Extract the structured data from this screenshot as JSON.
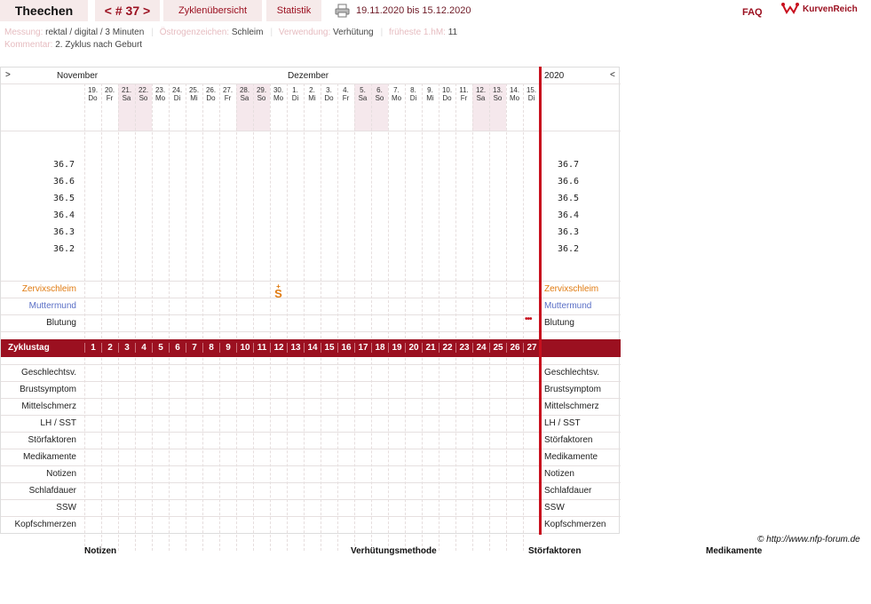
{
  "header": {
    "title": "Theechen",
    "cycle_prev": "<",
    "cycle_label": "# 37",
    "cycle_next": ">",
    "overview_label": "Zyklenübersicht",
    "stats_label": "Statistik",
    "date_range": "19.11.2020 bis 15.12.2020",
    "faq_label": "FAQ",
    "logo_text": "KurvenReich"
  },
  "meta": {
    "messung_key": "Messung:",
    "messung_val": "rektal / digital / 3 Minuten",
    "oestrogen_key": "Östrogenzeichen:",
    "oestrogen_val": "Schleim",
    "verwendung_key": "Verwendung:",
    "verwendung_val": "Verhütung",
    "fruehest_key": "früheste 1.hM:",
    "fruehest_val": "11",
    "kommentar_key": "Kommentar:",
    "kommentar_val": "2. Zyklus nach Geburt"
  },
  "chart": {
    "month_left": "November",
    "month_mid": "Dezember",
    "year": "2020",
    "nav_left": ">",
    "nav_right": "<",
    "days": [
      {
        "d": "19.",
        "w": "Do",
        "we": false
      },
      {
        "d": "20.",
        "w": "Fr",
        "we": false
      },
      {
        "d": "21.",
        "w": "Sa",
        "we": true
      },
      {
        "d": "22.",
        "w": "So",
        "we": true
      },
      {
        "d": "23.",
        "w": "Mo",
        "we": false
      },
      {
        "d": "24.",
        "w": "Di",
        "we": false
      },
      {
        "d": "25.",
        "w": "Mi",
        "we": false
      },
      {
        "d": "26.",
        "w": "Do",
        "we": false
      },
      {
        "d": "27.",
        "w": "Fr",
        "we": false
      },
      {
        "d": "28.",
        "w": "Sa",
        "we": true
      },
      {
        "d": "29.",
        "w": "So",
        "we": true
      },
      {
        "d": "30.",
        "w": "Mo",
        "we": false
      },
      {
        "d": "1.",
        "w": "Di",
        "we": false
      },
      {
        "d": "2.",
        "w": "Mi",
        "we": false
      },
      {
        "d": "3.",
        "w": "Do",
        "we": false
      },
      {
        "d": "4.",
        "w": "Fr",
        "we": false
      },
      {
        "d": "5.",
        "w": "Sa",
        "we": true
      },
      {
        "d": "6.",
        "w": "So",
        "we": true
      },
      {
        "d": "7.",
        "w": "Mo",
        "we": false
      },
      {
        "d": "8.",
        "w": "Di",
        "we": false
      },
      {
        "d": "9.",
        "w": "Mi",
        "we": false
      },
      {
        "d": "10.",
        "w": "Do",
        "we": false
      },
      {
        "d": "11.",
        "w": "Fr",
        "we": false
      },
      {
        "d": "12.",
        "w": "Sa",
        "we": true
      },
      {
        "d": "13.",
        "w": "So",
        "we": true
      },
      {
        "d": "14.",
        "w": "Mo",
        "we": false
      },
      {
        "d": "15.",
        "w": "Di",
        "we": false
      }
    ],
    "temps": [
      "36.7",
      "36.6",
      "36.5",
      "36.4",
      "36.3",
      "36.2"
    ],
    "zervix_label": "Zervixschleim",
    "muttermund_label": "Muttermund",
    "blutung_label": "Blutung",
    "zervix_mark_day": 12,
    "zervix_mark_symbol": "S",
    "zervix_mark_top": "+",
    "blutung_mark_day": 27,
    "zyklus_label": "Zyklustag",
    "zyklus_days": [
      "1",
      "2",
      "3",
      "4",
      "5",
      "6",
      "7",
      "8",
      "9",
      "10",
      "11",
      "12",
      "13",
      "14",
      "15",
      "16",
      "17",
      "18",
      "19",
      "20",
      "21",
      "22",
      "23",
      "24",
      "25",
      "26",
      "27"
    ],
    "bottom_rows": [
      "Geschlechtsv.",
      "Brustsymptom",
      "Mittelschmerz",
      "LH / SST",
      "Störfaktoren",
      "Medikamente",
      "Notizen",
      "Schlafdauer",
      "SSW",
      "Kopfschmerzen"
    ],
    "colors": {
      "zervix": "#e07a10",
      "muttermund": "#5a6fc6",
      "accent": "#9b1020"
    }
  },
  "footer": {
    "copyright": "© http://www.nfp-forum.de",
    "col1": "Notizen",
    "col2": "Verhütungsmethode",
    "col3": "Störfaktoren",
    "col4": "Medikamente"
  }
}
